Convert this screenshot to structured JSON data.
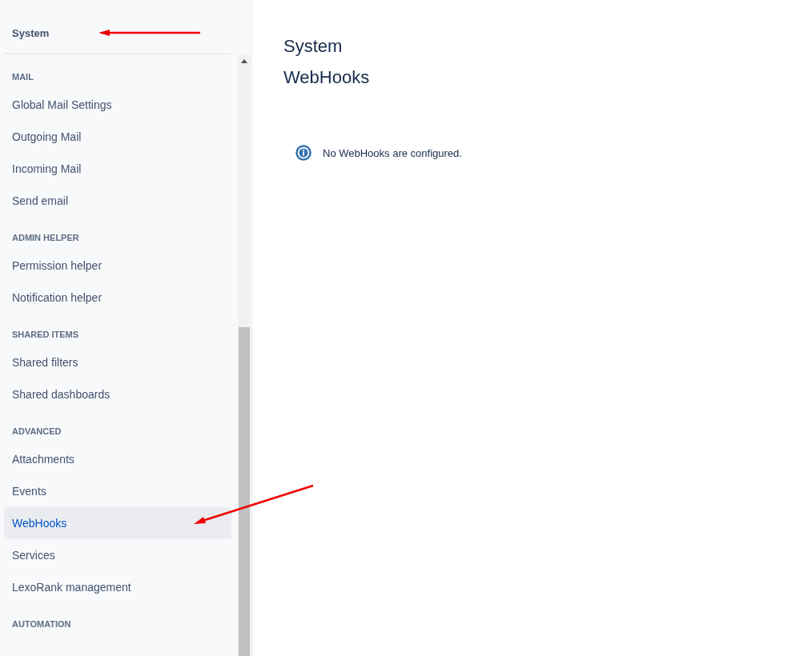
{
  "sidebar": {
    "title": "System",
    "sections": [
      {
        "heading": "MAIL",
        "items": [
          {
            "label": "Global Mail Settings",
            "selected": false
          },
          {
            "label": "Outgoing Mail",
            "selected": false
          },
          {
            "label": "Incoming Mail",
            "selected": false
          },
          {
            "label": "Send email",
            "selected": false
          }
        ]
      },
      {
        "heading": "ADMIN HELPER",
        "items": [
          {
            "label": "Permission helper",
            "selected": false
          },
          {
            "label": "Notification helper",
            "selected": false
          }
        ]
      },
      {
        "heading": "SHARED ITEMS",
        "items": [
          {
            "label": "Shared filters",
            "selected": false
          },
          {
            "label": "Shared dashboards",
            "selected": false
          }
        ]
      },
      {
        "heading": "ADVANCED",
        "items": [
          {
            "label": "Attachments",
            "selected": false
          },
          {
            "label": "Events",
            "selected": false
          },
          {
            "label": "WebHooks",
            "selected": true
          },
          {
            "label": "Services",
            "selected": false
          },
          {
            "label": "LexoRank management",
            "selected": false
          }
        ]
      },
      {
        "heading": "AUTOMATION"
      }
    ]
  },
  "main": {
    "breadcrumb": "System",
    "title": "WebHooks",
    "message": "No WebHooks are configured."
  }
}
